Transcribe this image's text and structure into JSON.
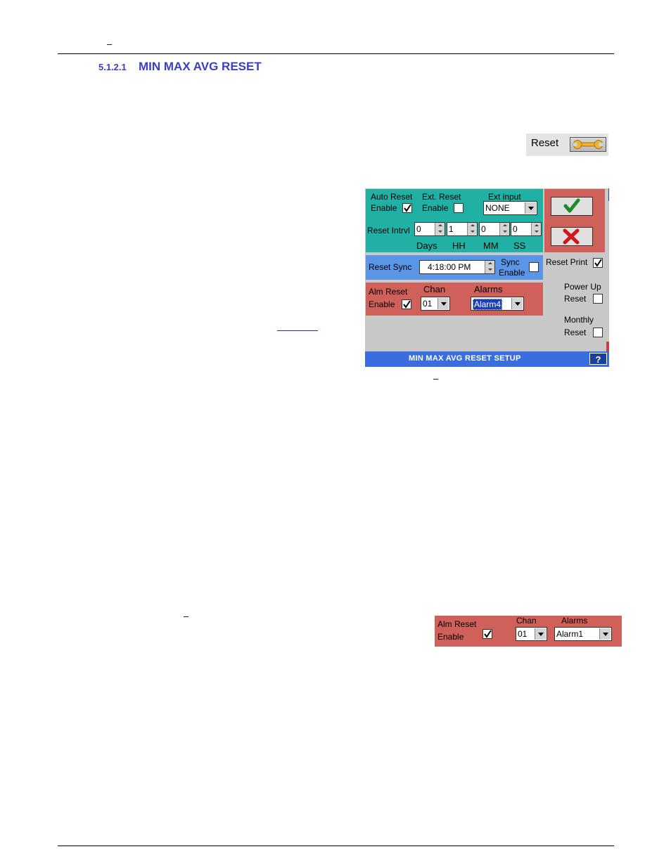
{
  "header": {
    "dash": "–"
  },
  "section": {
    "number": "5.1.2.1",
    "title": "MIN MAX AVG RESET"
  },
  "reset_button": {
    "label": "Reset",
    "icon": "wrench-icon"
  },
  "dialog": {
    "auto_reset_label": "Auto Reset",
    "auto_reset_enable_label": "Enable",
    "auto_reset_enabled": true,
    "ext_reset_label": "Ext. Reset",
    "ext_reset_enable_label": "Enable",
    "ext_reset_enabled": false,
    "ext_input_label": "Ext input",
    "ext_input_value": "NONE",
    "reset_intrvl_label": "Reset Intrvl",
    "interval": {
      "days": "0",
      "hh": "1",
      "mm": "0",
      "ss": "0"
    },
    "interval_units": {
      "days": "Days",
      "hh": "HH",
      "mm": "MM",
      "ss": "SS"
    },
    "reset_sync_label": "Reset Sync",
    "reset_sync_time": "4:18:00 PM",
    "sync_label": "Sync",
    "sync_enable_label": "Enable",
    "sync_enabled": false,
    "alm_reset_label": "Alm Reset",
    "alm_reset_enable_label": "Enable",
    "alm_reset_enabled": true,
    "chan_label": "Chan",
    "chan_value": "01",
    "alarms_label": "Alarms",
    "alarms_value": "Alarm4",
    "reset_print_label": "Reset Print",
    "reset_print_enabled": true,
    "power_up_label": "Power Up",
    "power_up_reset_label": "Reset",
    "power_up_enabled": false,
    "monthly_label": "Monthly",
    "monthly_reset_label": "Reset",
    "monthly_enabled": false,
    "title": "MIN MAX AVG RESET SETUP",
    "help_label": "?",
    "colors": {
      "teal": "#21b0a4",
      "red": "#d0605a",
      "blue": "#5a95e6",
      "titlebar": "#3a6ee0"
    }
  },
  "caption_dash": "–",
  "body_dash": "–",
  "alarm_snippet": {
    "alm_reset_label": "Alm Reset",
    "enable_label": "Enable",
    "enabled": true,
    "chan_label": "Chan",
    "chan_value": "01",
    "alarms_label": "Alarms",
    "alarms_value": "Alarm1"
  }
}
